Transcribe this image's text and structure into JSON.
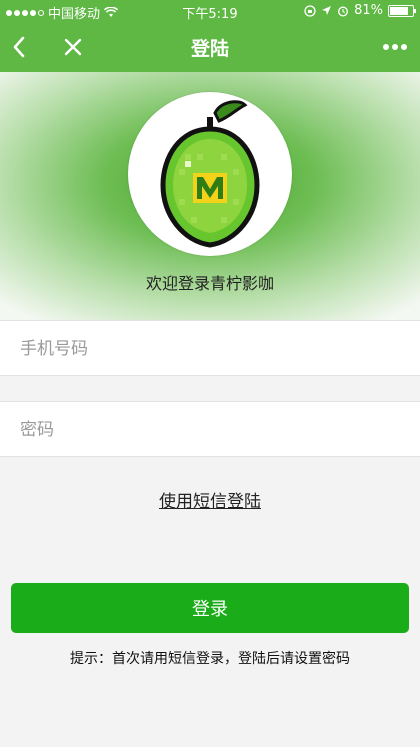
{
  "status_bar": {
    "carrier": "中国移动",
    "time": "下午5:19",
    "battery_text": "81%",
    "battery_level": 0.81
  },
  "nav": {
    "title": "登陆",
    "back_icon": "chevron-left-icon",
    "close_icon": "close-icon",
    "more_icon": "more-icon"
  },
  "hero": {
    "welcome_text": "欢迎登录青柠影咖",
    "logo_letter": "M"
  },
  "form": {
    "phone_placeholder": "手机号码",
    "phone_value": "",
    "password_placeholder": "密码",
    "password_value": "",
    "sms_login_link": "使用短信登陆",
    "login_button": "登录",
    "hint": "提示：首次请用短信登录，登陆后请设置密码"
  },
  "colors": {
    "header_green": "#5fb844",
    "button_green": "#1aad19"
  }
}
